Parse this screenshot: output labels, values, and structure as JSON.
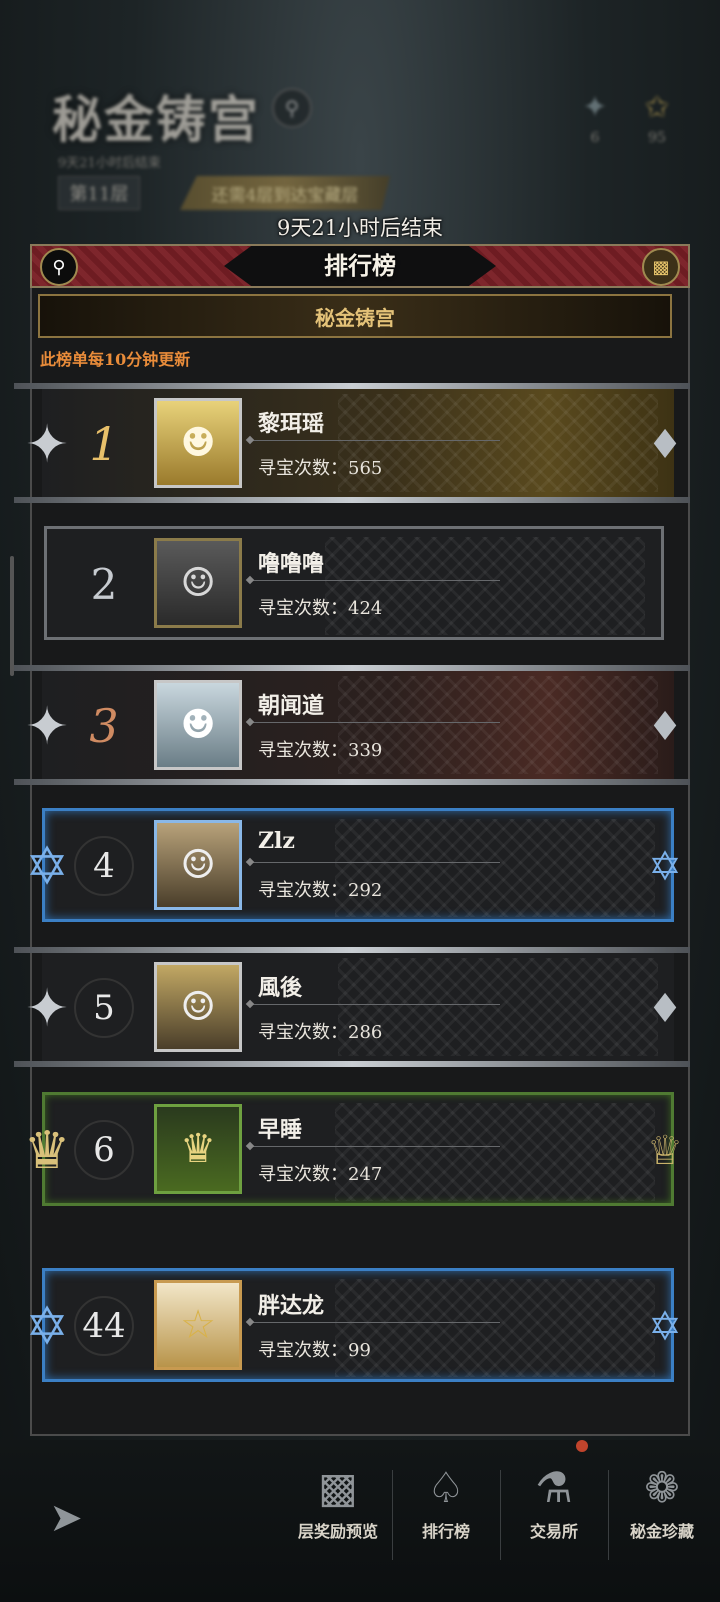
{
  "background": {
    "title": "秘金铸宫",
    "subtitle": "9天21小时后结束",
    "floor": "第11层",
    "floor_tag": "还需4层到达宝藏层",
    "resources": [
      {
        "icon": "crystal-icon",
        "value": "6"
      },
      {
        "icon": "coin-icon",
        "value": "95"
      }
    ]
  },
  "timer": "9天21小时后结束",
  "panel": {
    "title": "排行榜",
    "search_icon": "search-icon",
    "chest_icon": "chest-icon",
    "tab": "秘金铸宫",
    "update_note": "此榜单每10分钟更新"
  },
  "rows": [
    {
      "rank": "1",
      "name": "黎珥瑶",
      "stat": "寻宝次数：565"
    },
    {
      "rank": "2",
      "name": "噜噜噜",
      "stat": "寻宝次数：424"
    },
    {
      "rank": "3",
      "name": "朝闻道",
      "stat": "寻宝次数：339"
    },
    {
      "rank": "4",
      "name": "Zlz",
      "stat": "寻宝次数：292"
    },
    {
      "rank": "5",
      "name": "風後",
      "stat": "寻宝次数：286"
    },
    {
      "rank": "6",
      "name": "早睡",
      "stat": "寻宝次数：247"
    },
    {
      "rank": "44",
      "name": "胖达龙",
      "stat": "寻宝次数：99"
    }
  ],
  "bottom_nav": {
    "items": [
      {
        "label": "层奖励预览",
        "icon": "chest-icon"
      },
      {
        "label": "排行榜",
        "icon": "trophy-icon"
      },
      {
        "label": "交易所",
        "icon": "exchange-icon"
      },
      {
        "label": "秘金珍藏",
        "icon": "treasure-icon"
      }
    ]
  }
}
